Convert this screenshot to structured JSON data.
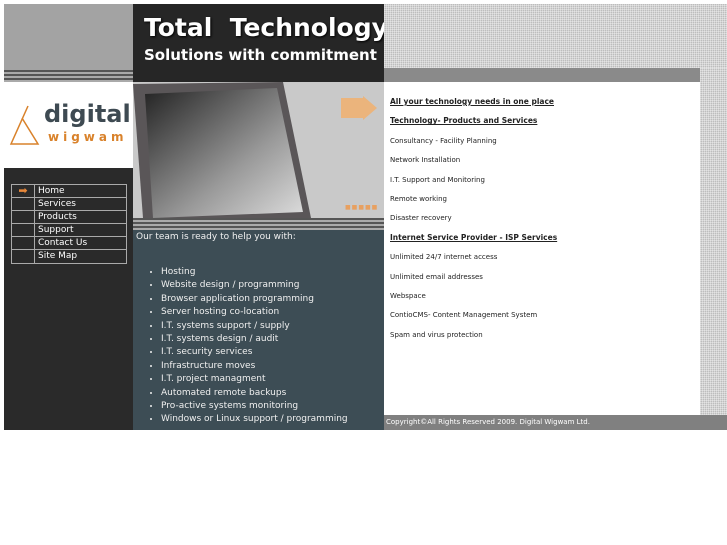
{
  "header": {
    "title": "Total  Technology",
    "subtitle": "Solutions with commitment"
  },
  "logo": {
    "text_top": "digital",
    "text_bottom": "wigwam"
  },
  "nav": {
    "items": [
      {
        "label": "Home",
        "icon": "arrow-right-icon",
        "active": true
      },
      {
        "label": "Services"
      },
      {
        "label": "Products"
      },
      {
        "label": "Support"
      },
      {
        "label": "Contact Us"
      },
      {
        "label": "Site Map"
      }
    ]
  },
  "main": {
    "intro": "Our team is ready to help you with:",
    "services": [
      "Hosting",
      "Website design / programming",
      "Browser application programming",
      "Server hosting co-location",
      "I.T. systems support / supply",
      "I.T. systems design / audit",
      "I.T. security services",
      "Infrastructure moves",
      "I.T. project managment",
      "Automated remote backups",
      "Pro-active systems monitoring",
      "Windows or Linux support / programming"
    ]
  },
  "right": {
    "items": [
      {
        "text": "All your technology needs in one place",
        "heading": true
      },
      {
        "text": "Technology- Products and Services",
        "heading": true
      },
      {
        "text": "Consultancy - Facility Planning"
      },
      {
        "text": "Network Installation"
      },
      {
        "text": "I.T. Support and Monitoring"
      },
      {
        "text": "Remote working"
      },
      {
        "text": "Disaster recovery"
      },
      {
        "text": "Internet Service Provider - ISP Services",
        "heading": true
      },
      {
        "text": "Unlimited 24/7 internet access"
      },
      {
        "text": "Unlimited email addresses"
      },
      {
        "text": "Webspace"
      },
      {
        "text": "ContioCMS- Content Management System"
      },
      {
        "text": "Spam and virus protection"
      }
    ]
  },
  "footer": {
    "copyright": "Copyright©All Rights Reserved 2009. Digital Wigwam Ltd."
  },
  "colors": {
    "accent": "#e8883a",
    "dark": "#262626",
    "slate": "#3d4d55"
  }
}
